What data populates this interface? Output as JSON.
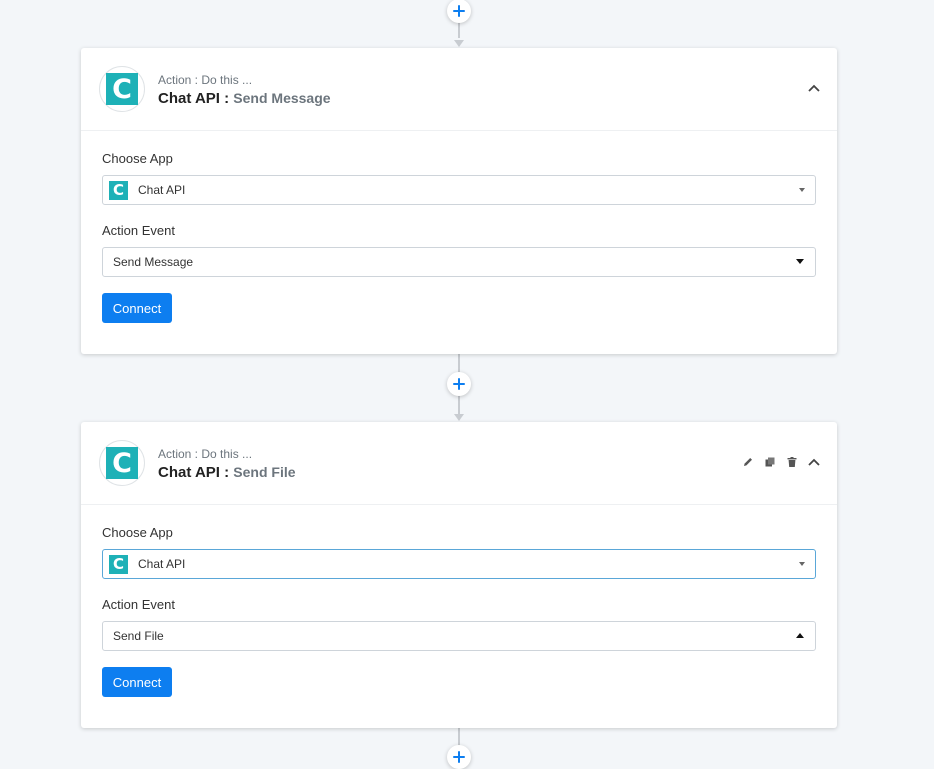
{
  "colors": {
    "accent": "#0d7ef0",
    "app_brand": "#1eb1b7",
    "connector": "#c8ccd1",
    "background": "#f3f6f9"
  },
  "icons": {
    "add_step": "plus-icon",
    "collapse": "chevron-up-icon",
    "edit": "pencil-icon",
    "copy": "copy-icon",
    "delete": "trash-icon",
    "app_logo_letter": "C"
  },
  "steps": [
    {
      "subtitle": "Action : Do this ...",
      "app_name": "Chat API :",
      "event_name": "Send Message",
      "choose_app_label": "Choose App",
      "choose_app_value": "Chat API",
      "action_event_label": "Action Event",
      "action_event_value": "Send Message",
      "connect_label": "Connect"
    },
    {
      "subtitle": "Action : Do this ...",
      "app_name": "Chat API :",
      "event_name": "Send File",
      "choose_app_label": "Choose App",
      "choose_app_value": "Chat API",
      "action_event_label": "Action Event",
      "action_event_value": "Send File",
      "connect_label": "Connect"
    }
  ]
}
